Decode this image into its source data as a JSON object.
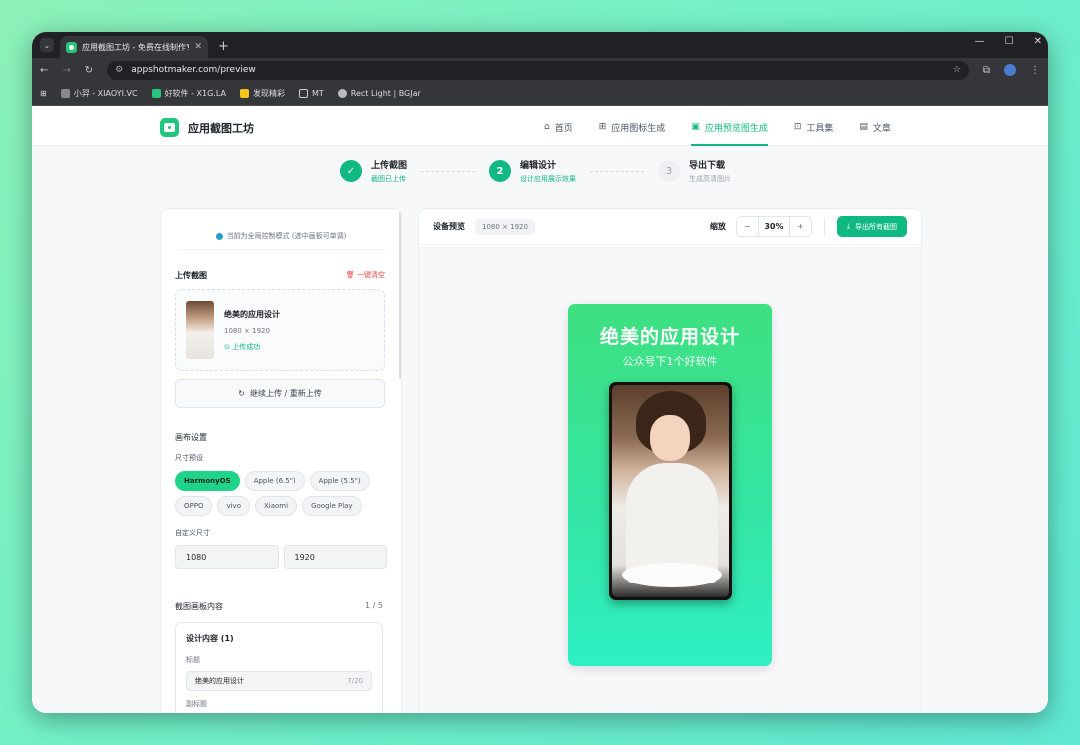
{
  "browser": {
    "tab_title": "应用截图工坊 - 免费在线制作专",
    "url": "appshotmaker.com/preview",
    "bookmarks": [
      "小羿 - XIAOYI.VC",
      "好软件 - X1G.LA",
      "发现精彩",
      "MT",
      "Rect Light | BGJar"
    ]
  },
  "nav": {
    "logo": "应用截图工坊",
    "items": [
      {
        "label": "首页",
        "icon": "home-icon"
      },
      {
        "label": "应用图标生成",
        "icon": "grid-icon"
      },
      {
        "label": "应用预览图生成",
        "icon": "image-icon"
      },
      {
        "label": "工具集",
        "icon": "toolbox-icon"
      },
      {
        "label": "文章",
        "icon": "document-icon"
      }
    ],
    "active": 2
  },
  "steps": [
    {
      "num": "✓",
      "title": "上传截图",
      "sub": "截图已上传"
    },
    {
      "num": "2",
      "title": "编辑设计",
      "sub": "设计应用展示效果"
    },
    {
      "num": "3",
      "title": "导出下载",
      "sub": "生成高清图片"
    }
  ],
  "left": {
    "mode_notice": "当前为全局控制模式 (选中画板可单调)",
    "upload_title": "上传截图",
    "clear_label": "一键清空",
    "file_name": "绝美的应用设计",
    "file_size": "1080 × 1920",
    "upload_status": "上传成功",
    "reupload_label": "继续上传 / 重新上传",
    "canvas_settings": "画布设置",
    "size_preset": "尺寸预设",
    "presets": [
      "HarmonyOS",
      "Apple (6.5\")",
      "Apple (5.5\")",
      "OPPO",
      "vivo",
      "Xiaomi",
      "Google Play"
    ],
    "custom_size": "自定义尺寸",
    "width": "1080",
    "height": "1920",
    "content_title": "截图画板内容",
    "page": "1 / 5",
    "design_title": "设计内容 (1)",
    "headline_label": "标题",
    "headline_value": "绝美的应用设计",
    "headline_count": "7/20",
    "subtitle_label": "副标题"
  },
  "right": {
    "device_label": "设备预览",
    "dimension": "1080 × 1920",
    "zoom_label": "缩放",
    "zoom_minus": "−",
    "zoom_value": "30%",
    "zoom_plus": "+",
    "export_label": "导出所有截图"
  },
  "poster": {
    "title": "绝美的应用设计",
    "subtitle": "公众号下1个好软件"
  },
  "colors": {
    "accent": "#10b981",
    "poster_top": "#3ee07f",
    "poster_bottom": "#2ef0c4"
  }
}
